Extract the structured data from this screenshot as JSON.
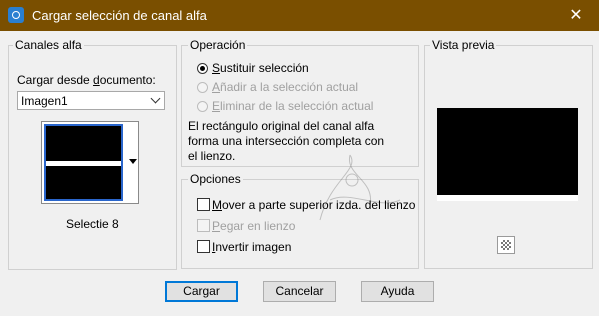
{
  "window": {
    "title": "Cargar selección de canal alfa",
    "close_glyph": "✕"
  },
  "canales": {
    "legend": "Canales alfa",
    "load_label_prefix": "Cargar desde ",
    "load_label_access": "d",
    "load_label_suffix": "ocumento:",
    "document_selected": "Imagen1",
    "channel_name": "Selectie 8"
  },
  "operacion": {
    "legend": "Operación",
    "options": [
      {
        "access": "S",
        "rest": "ustituir selección",
        "selected": true,
        "enabled": true
      },
      {
        "access": "A",
        "rest": "ñadir a la selección actual",
        "selected": false,
        "enabled": false
      },
      {
        "access": "E",
        "rest": "liminar de la selección actual",
        "selected": false,
        "enabled": false
      }
    ],
    "description_lines": [
      "El rectángulo original del canal alfa",
      "forma una intersección completa con",
      "el lienzo."
    ]
  },
  "opciones": {
    "legend": "Opciones",
    "items": [
      {
        "access": "M",
        "rest": "over a parte superior izda. del lienzo",
        "checked": false,
        "enabled": true
      },
      {
        "access": "P",
        "rest": "egar en lienzo",
        "checked": false,
        "enabled": false
      },
      {
        "access": "I",
        "rest": "nvertir imagen",
        "checked": false,
        "enabled": true
      }
    ]
  },
  "preview": {
    "legend": "Vista previa"
  },
  "buttons": {
    "load": "Cargar",
    "cancel": "Cancelar",
    "help": "Ayuda"
  },
  "colors": {
    "titlebar": "#7a4f00",
    "focus": "#0078d7"
  },
  "icons": {
    "app": "selection-icon",
    "close": "close-icon",
    "dropdown": "chevron-down-icon",
    "thumb_dropdown": "triangle-down-icon",
    "checkerboard": "checkerboard-icon"
  }
}
